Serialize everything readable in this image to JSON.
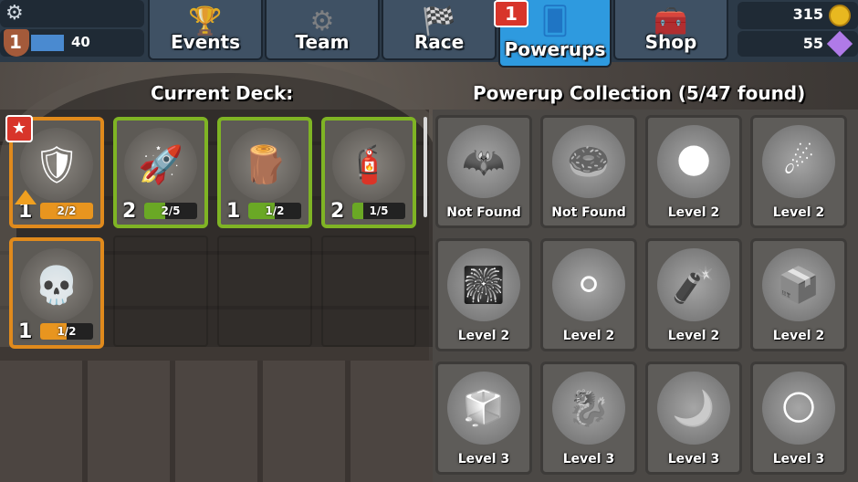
{
  "header": {
    "player_level": "1",
    "xp_value": "40",
    "coins": "315",
    "gems": "55",
    "tabs": [
      {
        "label": "Events",
        "icon": "trophy-icon",
        "glyph": "🏆"
      },
      {
        "label": "Team",
        "icon": "steering-wheel-icon",
        "glyph": "⚙"
      },
      {
        "label": "Race",
        "icon": "checkered-flags-icon",
        "glyph": "🏁"
      },
      {
        "label": "Powerups",
        "icon": "cards-icon",
        "glyph": "🂠"
      },
      {
        "label": "Shop",
        "icon": "treasure-chest-icon",
        "glyph": "🧰"
      }
    ],
    "powerups_badge": "1"
  },
  "deck": {
    "title": "Current Deck:",
    "star_badge": "★",
    "cards": [
      {
        "name": "shield",
        "icon": "shield-icon",
        "glyph": "🛡",
        "level": "1",
        "progress": "2/2",
        "fill": 1.0,
        "color": "orange"
      },
      {
        "name": "firework-rocket",
        "icon": "rocket-icon",
        "glyph": "🚀",
        "level": "2",
        "progress": "2/5",
        "fill": 0.4,
        "color": "green"
      },
      {
        "name": "spring-ramp",
        "icon": "ramp-spring-icon",
        "glyph": "🪵",
        "level": "1",
        "progress": "1/2",
        "fill": 0.5,
        "color": "green"
      },
      {
        "name": "nitro-tank",
        "icon": "nitro-tank-icon",
        "glyph": "🧯",
        "level": "2",
        "progress": "1/5",
        "fill": 0.2,
        "color": "green"
      },
      {
        "name": "skull",
        "icon": "skull-icon",
        "glyph": "💀",
        "level": "1",
        "progress": "1/2",
        "fill": 0.5,
        "color": "orange"
      }
    ]
  },
  "collection": {
    "title": "Powerup Collection (5/47 found)",
    "items": [
      {
        "icon": "bat-icon",
        "glyph": "🦇",
        "label": "Not Found"
      },
      {
        "icon": "donut-icon",
        "glyph": "🍩",
        "label": "Not Found"
      },
      {
        "icon": "cracked-orb-icon",
        "glyph": "🌑",
        "label": "Level 2"
      },
      {
        "icon": "comet-icon",
        "glyph": "☄",
        "label": "Level 2"
      },
      {
        "icon": "rockets-bundle-icon",
        "glyph": "🎆",
        "label": "Level 2"
      },
      {
        "icon": "glowing-orb-icon",
        "glyph": "⚪",
        "label": "Level 2"
      },
      {
        "icon": "dynamite-icon",
        "glyph": "🧨",
        "label": "Level 2"
      },
      {
        "icon": "crate-creatures-icon",
        "glyph": "📦",
        "label": "Level 2"
      },
      {
        "icon": "ice-cube-icon",
        "glyph": "🧊",
        "label": "Level 3"
      },
      {
        "icon": "dragon-icon",
        "glyph": "🐉",
        "label": "Level 3"
      },
      {
        "icon": "horns-icon",
        "glyph": "🌙",
        "label": "Level 3"
      },
      {
        "icon": "moon-stars-icon",
        "glyph": "🌕",
        "label": "Level 3"
      }
    ]
  }
}
